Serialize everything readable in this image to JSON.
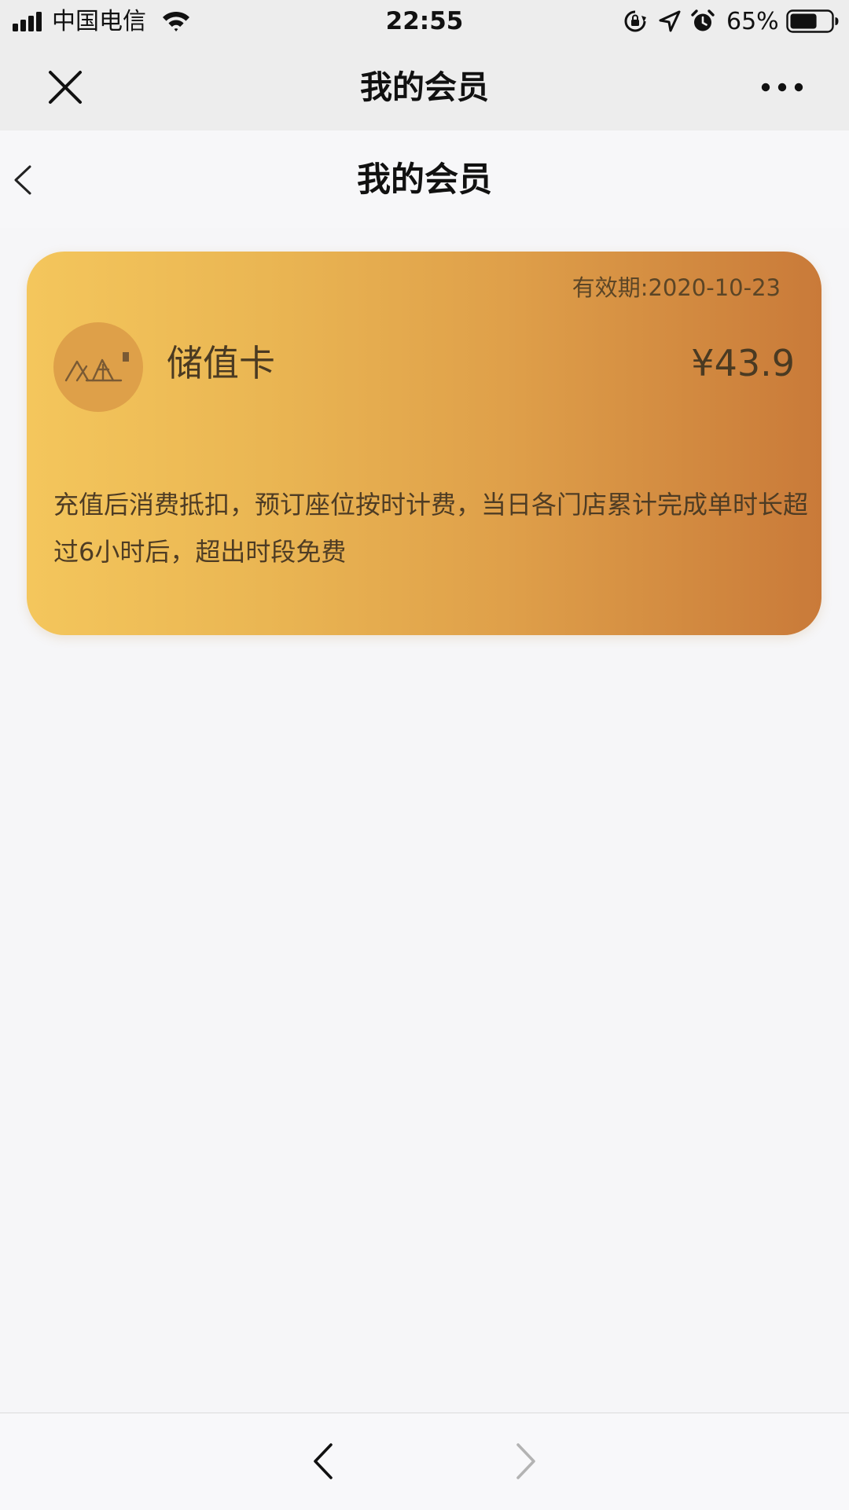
{
  "status_bar": {
    "carrier": "中国电信",
    "time": "22:55",
    "battery_percent": "65%",
    "battery_level": 0.65,
    "signal_bars": 4,
    "icons": [
      "signal-icon",
      "wifi-icon",
      "orientation-lock-icon",
      "location-arrow-icon",
      "alarm-clock-icon",
      "battery-icon"
    ]
  },
  "nav_bar": {
    "title": "我的会员",
    "icons": [
      "close-icon",
      "more-icon"
    ]
  },
  "page_header": {
    "title": "我的会员",
    "icons": [
      "back-icon"
    ]
  },
  "card": {
    "validity": "有效期:2020-10-23",
    "name": "储值卡",
    "balance": "¥43.9",
    "description": "充值后消费抵扣，预订座位按时计费，当日各门店累计完成单时长超过6小时后，超出时段免费",
    "colors": {
      "gradient_start": "#f4c65c",
      "gradient_end": "#c97a39",
      "logo_circle": "#dea049",
      "text": "#4a3a22"
    },
    "icons": [
      "store-logo-icon"
    ]
  },
  "bottom_bar": {
    "icons": [
      "back-arrow-icon",
      "forward-arrow-icon"
    ],
    "forward_enabled": false
  }
}
